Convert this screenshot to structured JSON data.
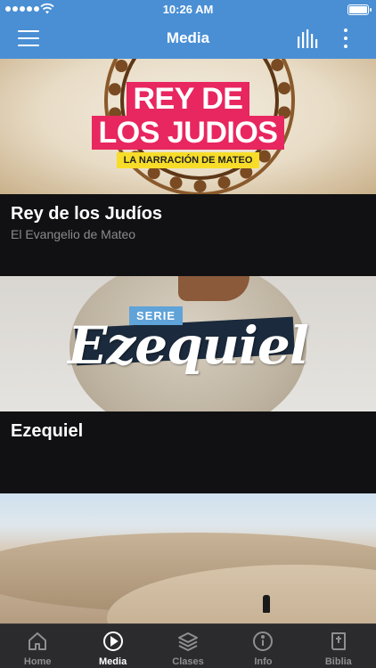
{
  "status_bar": {
    "time": "10:26 AM",
    "signal_dots": 5,
    "battery_level": 1.0
  },
  "header": {
    "title": "Media"
  },
  "feed": [
    {
      "title": "Rey de los Judíos",
      "subtitle": "El Evangelio de Mateo",
      "artwork": {
        "line1": "REY DE",
        "line2": "LOS JUDIOS",
        "tagline": "LA NARRACIÓN DE MATEO"
      }
    },
    {
      "title": "Ezequiel",
      "subtitle": "",
      "artwork": {
        "badge": "SERIE",
        "script": "Ezequiel"
      }
    },
    {
      "title": "",
      "subtitle": ""
    }
  ],
  "tabs": [
    {
      "label": "Home",
      "icon": "home-icon",
      "active": false
    },
    {
      "label": "Media",
      "icon": "play-circle-icon",
      "active": true
    },
    {
      "label": "Clases",
      "icon": "layers-icon",
      "active": false
    },
    {
      "label": "Info",
      "icon": "info-icon",
      "active": false
    },
    {
      "label": "Biblia",
      "icon": "bible-icon",
      "active": false
    }
  ],
  "colors": {
    "header_blue": "#4a8fd4",
    "background": "#111113",
    "tab_bar": "#2b2b2d",
    "tab_inactive": "#8e8e93",
    "tab_active": "#ffffff",
    "accent_pink": "#e8265f",
    "accent_yellow": "#f7dd2a",
    "accent_light_blue": "#5fa3d8"
  }
}
